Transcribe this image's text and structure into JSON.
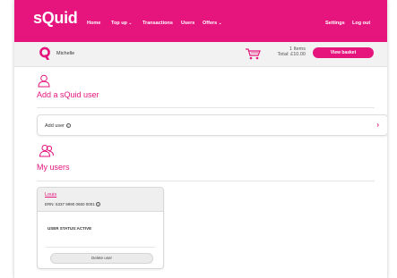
{
  "header": {
    "logo": "sQuid",
    "nav": {
      "home": "Home",
      "topup": "Top up",
      "transactions": "Transactions",
      "users": "Users",
      "offers": "Offers",
      "settings": "Settings",
      "logout": "Log out"
    },
    "chevron": "⌄"
  },
  "userbar": {
    "name": "Michelle",
    "basket_items": "1 Items",
    "basket_total": "Total: £10.00",
    "view_basket": "View basket"
  },
  "add_section": {
    "title": "Add a sQuid user",
    "row_label": "Add user",
    "info_icon": "i",
    "arrow": "›"
  },
  "users_section": {
    "title": "My users",
    "users": [
      {
        "name": "Louis",
        "ern": "ERN: 6337 9990 0650 0001",
        "status": "USER STATUS:ACTIVE",
        "delete_label": "Delete user"
      }
    ]
  },
  "colors": {
    "brand": "#e6157d",
    "bar_bg": "#f2f2f2"
  }
}
